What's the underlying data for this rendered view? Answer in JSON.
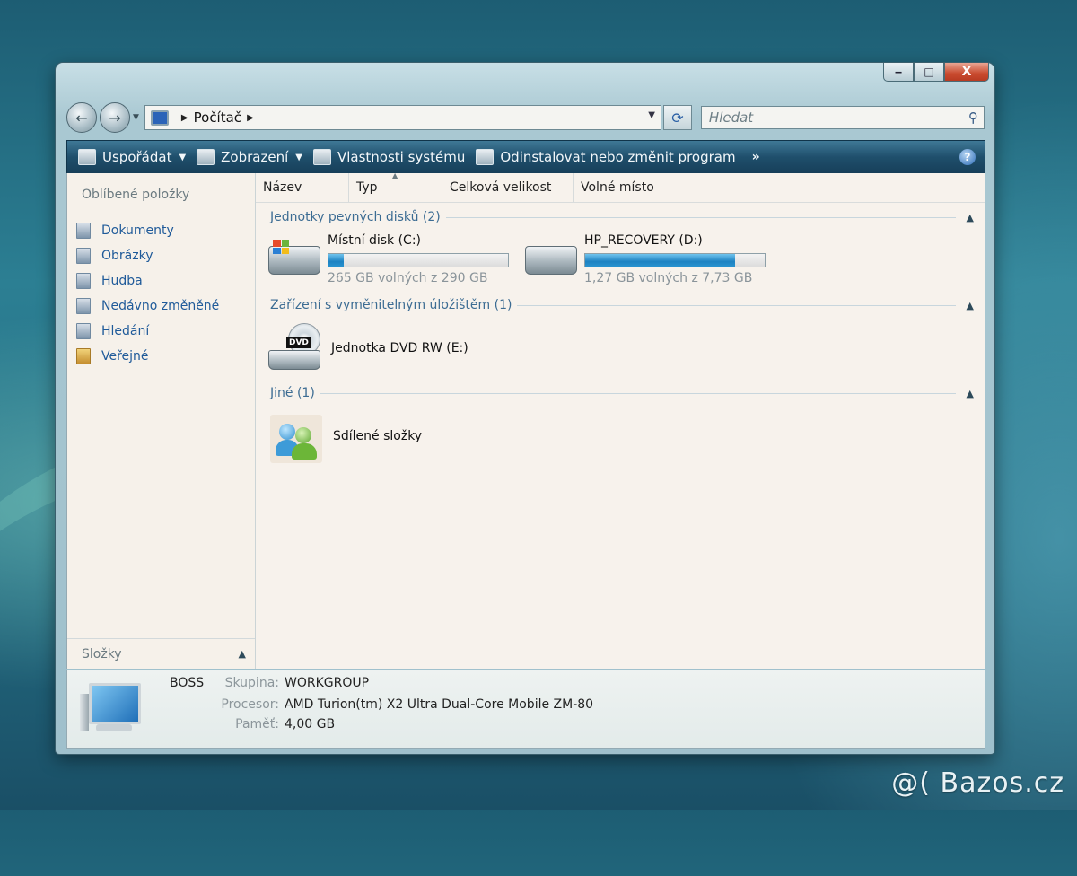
{
  "window": {
    "caption": {
      "minimize": "‒",
      "maximize": "□",
      "close": "X"
    }
  },
  "nav": {
    "back_icon": "←",
    "forward_icon": "→",
    "address_segments": [
      "Počítač"
    ],
    "search_placeholder": "Hledat"
  },
  "toolbar": {
    "organize": "Uspořádat",
    "views": "Zobrazení",
    "system_properties": "Vlastnosti systému",
    "uninstall": "Odinstalovat nebo změnit program",
    "more": "»"
  },
  "sidebar": {
    "title": "Oblíbené položky",
    "items": [
      {
        "label": "Dokumenty",
        "icon": "documents-icon"
      },
      {
        "label": "Obrázky",
        "icon": "pictures-icon"
      },
      {
        "label": "Hudba",
        "icon": "music-icon"
      },
      {
        "label": "Nedávno změněné",
        "icon": "recent-icon"
      },
      {
        "label": "Hledání",
        "icon": "searches-icon"
      },
      {
        "label": "Veřejné",
        "icon": "public-folder-icon"
      }
    ],
    "folders_label": "Složky"
  },
  "columns": [
    "Název",
    "Typ",
    "Celková velikost",
    "Volné místo"
  ],
  "groups": {
    "hard_drives": {
      "label": "Jednotky pevných disků (2)",
      "drives": [
        {
          "name": "Místní disk (C:)",
          "free_text": "265 GB volných z 290 GB",
          "used_fraction": 0.086
        },
        {
          "name": "HP_RECOVERY (D:)",
          "free_text": "1,27 GB volných z 7,73 GB",
          "used_fraction": 0.836
        }
      ]
    },
    "removable": {
      "label": "Zařízení s vyměnitelným úložištěm (1)",
      "items": [
        {
          "name": "Jednotka DVD RW (E:)",
          "badge": "DVD"
        }
      ]
    },
    "other": {
      "label": "Jiné (1)",
      "items": [
        {
          "name": "Sdílené složky"
        }
      ]
    }
  },
  "details": {
    "computer_name": "BOSS",
    "workgroup_label": "Skupina:",
    "workgroup": "WORKGROUP",
    "processor_label": "Procesor:",
    "processor": "AMD Turion(tm) X2 Ultra Dual-Core Mobile ZM-80",
    "memory_label": "Paměť:",
    "memory": "4,00 GB"
  },
  "watermark": "@( Bazos.cz"
}
